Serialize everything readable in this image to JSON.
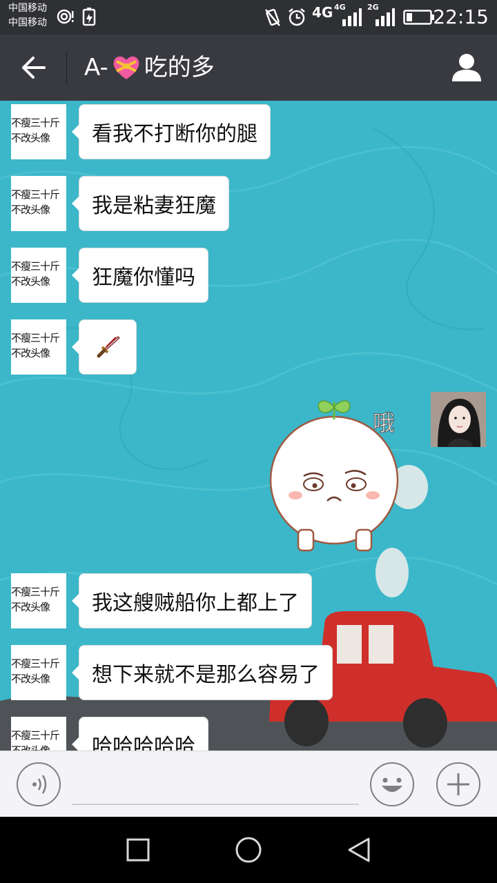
{
  "status_bar": {
    "carrier_1": "中国移动",
    "carrier_2": "中国移动",
    "network_1": "4G",
    "network_2": "4G",
    "network_3": "2G",
    "time": "22:15"
  },
  "header": {
    "title_prefix": "A-",
    "title_suffix": "吃的多",
    "back_icon": "arrow-left-icon",
    "profile_icon": "person-icon"
  },
  "contact_avatar": {
    "line1": "不瘦三十斤",
    "line2": "不改头像"
  },
  "messages": [
    {
      "text": "看我不打断你的腿"
    },
    {
      "text": "我是粘妻狂魔"
    },
    {
      "text": "狂魔你懂吗"
    },
    {
      "text": "",
      "icon": "dagger-emoji-icon"
    },
    {
      "text": "我这艘贼船你上都上了"
    },
    {
      "text": "想下来就不是那么容易了"
    },
    {
      "text": "哈哈哈哈哈"
    }
  ],
  "sticker": {
    "caption": "哦"
  },
  "colors": {
    "status_bg": "#2f3033",
    "header_bg": "#393a3f",
    "chat_bg": "#3bb7c9",
    "bubble_bg": "#ffffff",
    "inputbar_bg": "#f4f4f6"
  }
}
